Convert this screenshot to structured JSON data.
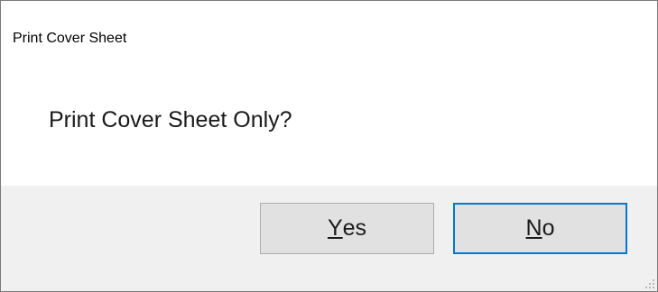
{
  "window": {
    "title": "Print Cover Sheet"
  },
  "dialog": {
    "message": "Print Cover Sheet Only?"
  },
  "buttons": {
    "yes": {
      "mnemonic": "Y",
      "rest": "es"
    },
    "no": {
      "mnemonic": "N",
      "rest": "o"
    },
    "default_button": "no"
  },
  "colors": {
    "focus_border": "#0078d7",
    "button_face": "#e1e1e1",
    "button_area": "#f0f0f0"
  },
  "icons": [
    "resize-grip-icon"
  ]
}
